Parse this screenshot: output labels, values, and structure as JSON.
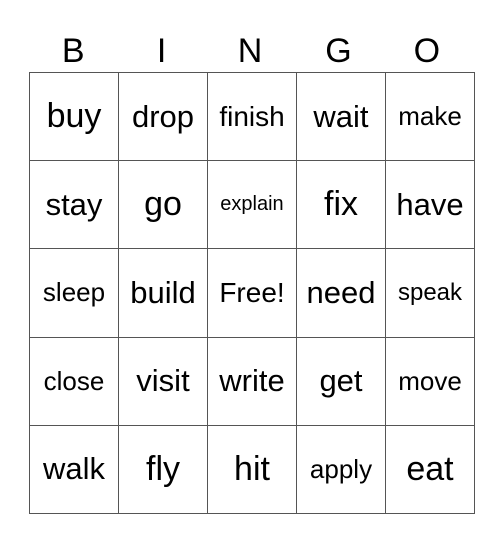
{
  "header": [
    "B",
    "I",
    "N",
    "G",
    "O"
  ],
  "rows": [
    [
      "buy",
      "drop",
      "finish",
      "wait",
      "make"
    ],
    [
      "stay",
      "go",
      "explain",
      "fix",
      "have"
    ],
    [
      "sleep",
      "build",
      "Free!",
      "need",
      "speak"
    ],
    [
      "close",
      "visit",
      "write",
      "get",
      "move"
    ],
    [
      "walk",
      "fly",
      "hit",
      "apply",
      "eat"
    ]
  ]
}
